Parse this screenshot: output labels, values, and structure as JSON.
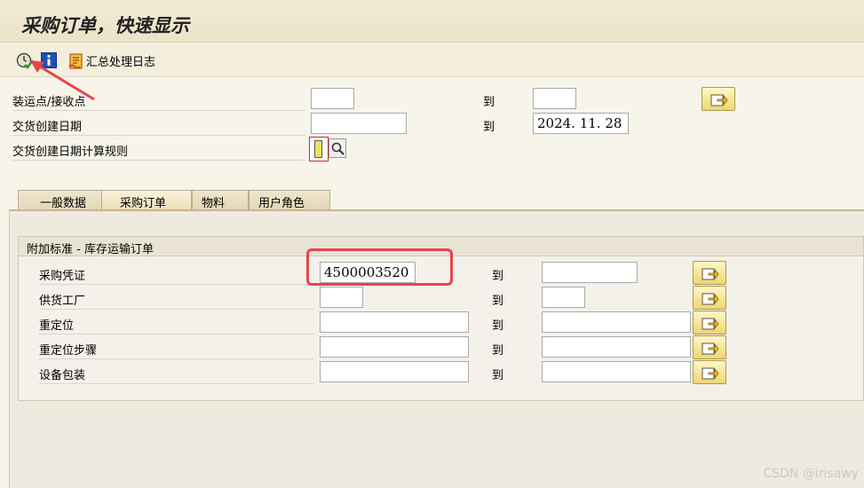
{
  "window": {
    "title": "采购订单，快速显示"
  },
  "toolbar": {
    "log_label": "汇总处理日志",
    "icons": [
      "execute-clock-icon",
      "info-icon",
      "log-icon"
    ]
  },
  "header_fields": [
    {
      "label": "装运点/接收点",
      "from_value": "",
      "to_label": "到",
      "to_value": ""
    },
    {
      "label": "交货创建日期",
      "from_value": "",
      "to_label": "到",
      "to_value": "2024. 11. 28"
    },
    {
      "label": "交货创建日期计算规则",
      "value": ""
    }
  ],
  "tabs": [
    {
      "label": "一般数据",
      "active": false
    },
    {
      "label": "采购订单",
      "active": true
    },
    {
      "label": "物料",
      "active": false
    },
    {
      "label": "用户角色",
      "active": false
    }
  ],
  "group": {
    "title": "附加标准 - 库存运输订单",
    "rows": [
      {
        "label": "采购凭证",
        "from_value": "4500003520",
        "to_label": "到",
        "to_value": ""
      },
      {
        "label": "供货工厂",
        "from_value": "",
        "to_label": "到",
        "to_value": ""
      },
      {
        "label": "重定位",
        "from_value": "",
        "to_label": "到",
        "to_value": ""
      },
      {
        "label": "重定位步骤",
        "from_value": "",
        "to_label": "到",
        "to_value": ""
      },
      {
        "label": "设备包装",
        "from_value": "",
        "to_label": "到",
        "to_value": ""
      }
    ]
  },
  "watermark": "CSDN @irisawy",
  "colors": {
    "highlight_box": "#e8434b",
    "arrow": "#e8434b",
    "multisel_button": "#f0d670"
  }
}
